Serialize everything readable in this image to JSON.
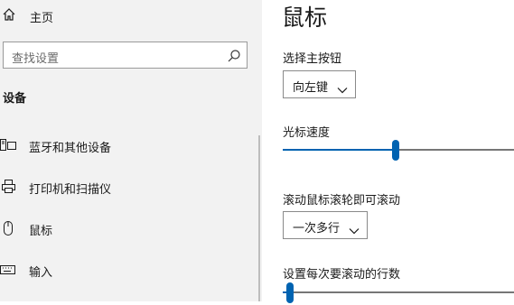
{
  "sidebar": {
    "home_label": "主页",
    "search": {
      "placeholder": "查找设置"
    },
    "section_heading": "设备",
    "items": [
      {
        "label": "蓝牙和其他设备",
        "icon": "bluetooth-devices-icon"
      },
      {
        "label": "打印机和扫描仪",
        "icon": "printer-icon"
      },
      {
        "label": "鼠标",
        "icon": "mouse-icon"
      },
      {
        "label": "输入",
        "icon": "keyboard-icon"
      }
    ]
  },
  "main": {
    "title": "鼠标",
    "primary_button": {
      "label": "选择主按钮",
      "value": "向左键"
    },
    "cursor_speed": {
      "label": "光标速度",
      "level": 0.49
    },
    "wheel_scroll": {
      "label": "滚动鼠标滚轮即可滚动",
      "value": "一次多行"
    },
    "lines_per_scroll": {
      "label": "设置每次要滚动的行数",
      "level": 0.03
    }
  },
  "colors": {
    "sidebar_bg": "#f2f2f2",
    "accent": "#0063b1",
    "track": "#767676"
  }
}
